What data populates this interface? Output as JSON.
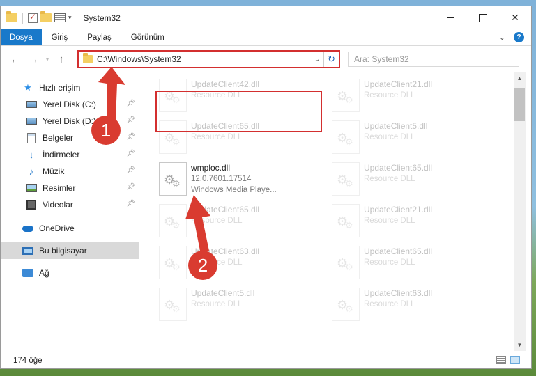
{
  "window": {
    "title": "System32"
  },
  "ribbon": {
    "tabs": [
      "Dosya",
      "Giriş",
      "Paylaş",
      "Görünüm"
    ],
    "help_label": "?"
  },
  "address": {
    "path": "C:\\Windows\\System32",
    "search_placeholder": "Ara: System32"
  },
  "sidebar": {
    "items": [
      {
        "label": "Hızlı erişim",
        "icon": "star-icon"
      },
      {
        "label": "Yerel Disk (C:)",
        "icon": "drive-icon",
        "pinned": true
      },
      {
        "label": "Yerel Disk (D:)",
        "icon": "drive-icon",
        "pinned": true
      },
      {
        "label": "Belgeler",
        "icon": "documents-icon",
        "pinned": true
      },
      {
        "label": "İndirmeler",
        "icon": "download-icon",
        "pinned": true
      },
      {
        "label": "Müzik",
        "icon": "music-icon",
        "pinned": true
      },
      {
        "label": "Resimler",
        "icon": "pictures-icon",
        "pinned": true
      },
      {
        "label": "Videolar",
        "icon": "videos-icon",
        "pinned": true
      },
      {
        "label": "OneDrive",
        "icon": "onedrive-icon"
      },
      {
        "label": "Bu bilgisayar",
        "icon": "computer-icon",
        "selected": true
      },
      {
        "label": "Ağ",
        "icon": "network-icon"
      }
    ]
  },
  "files": [
    {
      "name": "UpdateClient42.dll",
      "desc": "Resource DLL",
      "version": ""
    },
    {
      "name": "UpdateClient21.dll",
      "desc": "Resource DLL",
      "version": ""
    },
    {
      "name": "UpdateClient65.dll",
      "desc": "Resource DLL",
      "version": ""
    },
    {
      "name": "UpdateClient5.dll",
      "desc": "Resource DLL",
      "version": ""
    },
    {
      "name": "wmploc.dll",
      "version": "12.0.7601.17514",
      "desc": "Windows Media Playe..."
    },
    {
      "name": "UpdateClient65.dll",
      "desc": "Resource DLL",
      "version": ""
    },
    {
      "name": "UpdateClient65.dll",
      "desc": "Resource DLL",
      "version": ""
    },
    {
      "name": "UpdateClient21.dll",
      "desc": "Resource DLL",
      "version": ""
    },
    {
      "name": "UpdateClient63.dll",
      "desc": "Resource DLL",
      "version": ""
    },
    {
      "name": "UpdateClient65.dll",
      "desc": "Resource DLL",
      "version": ""
    },
    {
      "name": "UpdateClient5.dll",
      "desc": "Resource DLL",
      "version": ""
    },
    {
      "name": "UpdateClient63.dll",
      "desc": "Resource DLL",
      "version": ""
    }
  ],
  "status": {
    "item_count": "174 öğe"
  },
  "annotations": {
    "step1": "1",
    "step2": "2",
    "color": "#d93b30"
  }
}
